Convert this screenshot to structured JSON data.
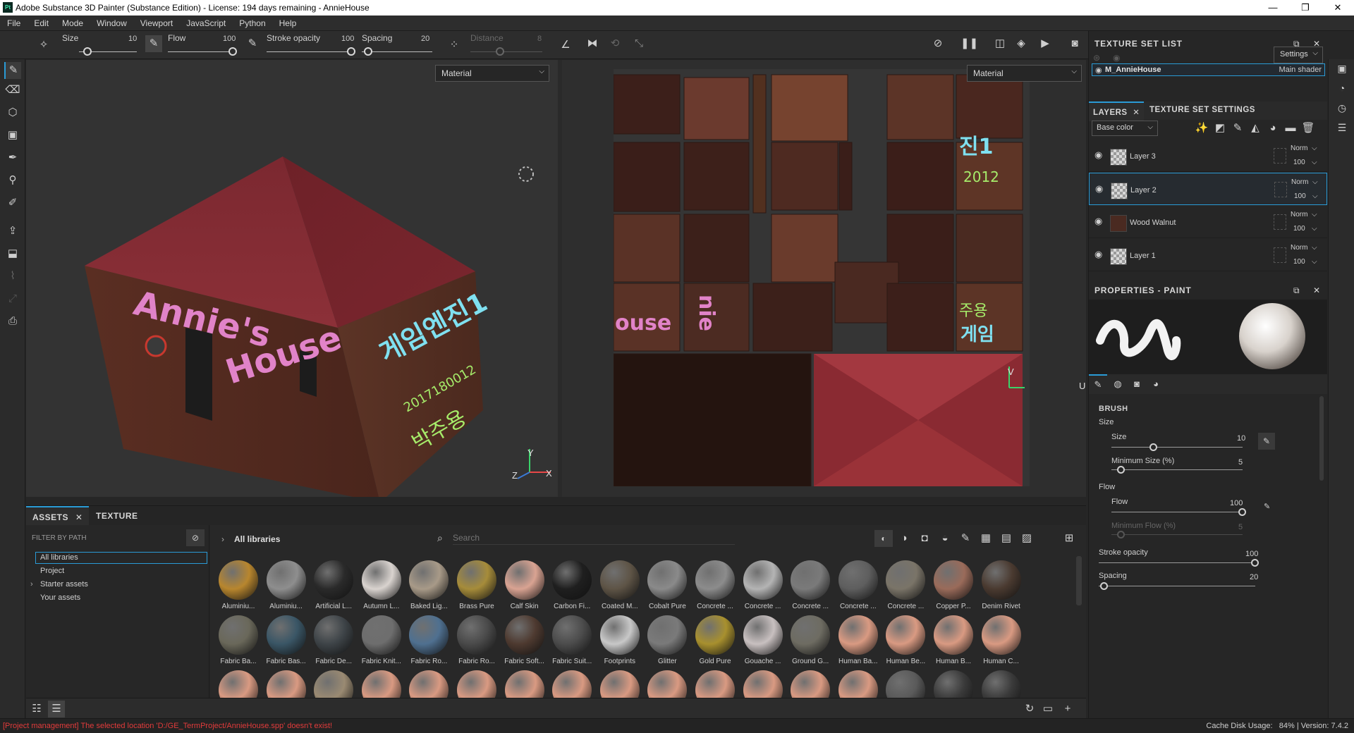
{
  "window": {
    "title": "Adobe Substance 3D Painter (Substance Edition) - License: 194 days remaining - AnnieHouse",
    "logo": "Pt",
    "controls": {
      "minimize": "—",
      "maximize": "❐",
      "close": "✕"
    }
  },
  "menu": [
    "File",
    "Edit",
    "Mode",
    "Window",
    "Viewport",
    "JavaScript",
    "Python",
    "Help"
  ],
  "toolbar": {
    "size_label": "Size",
    "size_value": "10",
    "flow_label": "Flow",
    "flow_value": "100",
    "stroke_opacity_label": "Stroke opacity",
    "stroke_opacity_value": "100",
    "spacing_label": "Spacing",
    "spacing_value": "20",
    "distance_label": "Distance",
    "distance_value": "8"
  },
  "viewport3d": {
    "mode": "Material",
    "axis_y": "Y",
    "axis_x": "X",
    "axis_z": "Z",
    "model_text_front": "Annie's House",
    "model_text_side": "게임엔진1 2017180012 박주용"
  },
  "viewport2d": {
    "mode": "Material",
    "axis_v": "V",
    "axis_u": "U"
  },
  "bottom_tabs": {
    "assets": "ASSETS",
    "texture": "TEXTURE"
  },
  "filter": {
    "label": "FILTER BY PATH",
    "items": [
      "All libraries",
      "Project",
      "Starter assets",
      "Your assets"
    ],
    "expand_glyph": "›"
  },
  "assets": {
    "breadcrumb": "All libraries",
    "search_placeholder": "Search",
    "row1": [
      {
        "name": "Aluminiu...",
        "color": "#b8862e"
      },
      {
        "name": "Aluminiu...",
        "color": "#8e8e8e"
      },
      {
        "name": "Artificial L...",
        "color": "#2a2a2a"
      },
      {
        "name": "Autumn L...",
        "color": "#d9d3cf"
      },
      {
        "name": "Baked Lig...",
        "color": "#a89a88"
      },
      {
        "name": "Brass Pure",
        "color": "#a68c3a"
      },
      {
        "name": "Calf Skin",
        "color": "#d9a392"
      },
      {
        "name": "Carbon Fi...",
        "color": "#1f1f1f"
      },
      {
        "name": "Coated M...",
        "color": "#5e5446"
      },
      {
        "name": "Cobalt Pure",
        "color": "#8a8a8a"
      },
      {
        "name": "Concrete ...",
        "color": "#8c8c8c"
      },
      {
        "name": "Concrete ...",
        "color": "#b4b4b4"
      },
      {
        "name": "Concrete ...",
        "color": "#7a7a7a"
      },
      {
        "name": "Concrete ...",
        "color": "#5e5e5e"
      },
      {
        "name": "Concrete ...",
        "color": "#7a7468"
      },
      {
        "name": "Copper P...",
        "color": "#9a6b5a"
      },
      {
        "name": "Denim Rivet",
        "color": "#4a3a30"
      }
    ],
    "row2": [
      {
        "name": "Fabric Ba...",
        "color": "#6a685a"
      },
      {
        "name": "Fabric Bas...",
        "color": "#3a5666"
      },
      {
        "name": "Fabric De...",
        "color": "#3e4448"
      },
      {
        "name": "Fabric Knit...",
        "color": "#6e6e6e"
      },
      {
        "name": "Fabric Ro...",
        "color": "#4f7090"
      },
      {
        "name": "Fabric Ro...",
        "color": "#4a4a4a"
      },
      {
        "name": "Fabric Soft...",
        "color": "#4e3a30"
      },
      {
        "name": "Fabric Suit...",
        "color": "#4c4c4c"
      },
      {
        "name": "Footprints",
        "color": "#c8c8c8"
      },
      {
        "name": "Glitter",
        "color": "#7a7a7a"
      },
      {
        "name": "Gold Pure",
        "color": "#a8902e"
      },
      {
        "name": "Gouache ...",
        "color": "#c8c0c0"
      },
      {
        "name": "Ground G...",
        "color": "#6e6c62"
      },
      {
        "name": "Human Ba...",
        "color": "#d99a82"
      },
      {
        "name": "Human Be...",
        "color": "#d99a82"
      },
      {
        "name": "Human B...",
        "color": "#d99a82"
      },
      {
        "name": "Human C...",
        "color": "#d99a82"
      }
    ],
    "row3_colors": [
      "#d99a82",
      "#d99a82",
      "#9a8a72",
      "#d99a82",
      "#d99a82",
      "#d99a82",
      "#d99a82",
      "#d99a82",
      "#d99a82",
      "#d99a82",
      "#d99a82",
      "#d99a82",
      "#d99a82",
      "#d99a82",
      "#5a5a5a",
      "#3a3a3a",
      "#3a3a3a"
    ]
  },
  "status": {
    "error": "[Project management] The selected location 'D:/GE_TermProject/AnnieHouse.spp' doesn't exist!",
    "right": "Cache Disk Usage:   84% | Version: 7.4.2"
  },
  "texture_set_list": {
    "title": "TEXTURE SET LIST",
    "settings": "Settings",
    "item_name": "M_AnnieHouse",
    "item_shader": "Main shader"
  },
  "layers_panel": {
    "tab_layers": "LAYERS",
    "tab_settings": "TEXTURE SET SETTINGS",
    "channel": "Base color",
    "layers": [
      {
        "name": "Layer 3",
        "blend": "Norm",
        "opacity": "100"
      },
      {
        "name": "Layer 2",
        "blend": "Norm",
        "opacity": "100"
      },
      {
        "name": "Wood Walnut",
        "blend": "Norm",
        "opacity": "100"
      },
      {
        "name": "Layer 1",
        "blend": "Norm",
        "opacity": "100"
      }
    ]
  },
  "properties": {
    "title": "PROPERTIES - PAINT",
    "section_brush": "BRUSH",
    "size_group": "Size",
    "size_label": "Size",
    "size_value": "10",
    "min_size_label": "Minimum Size (%)",
    "min_size_value": "5",
    "flow_group": "Flow",
    "flow_label": "Flow",
    "flow_value": "100",
    "min_flow_label": "Minimum Flow (%)",
    "min_flow_value": "5",
    "stroke_opacity_label": "Stroke opacity",
    "stroke_opacity_value": "100",
    "spacing_label": "Spacing",
    "spacing_value": "20"
  },
  "colors": {
    "accent": "#2a9bd6",
    "error": "#e23b3b",
    "roof": "#8a2a32"
  }
}
